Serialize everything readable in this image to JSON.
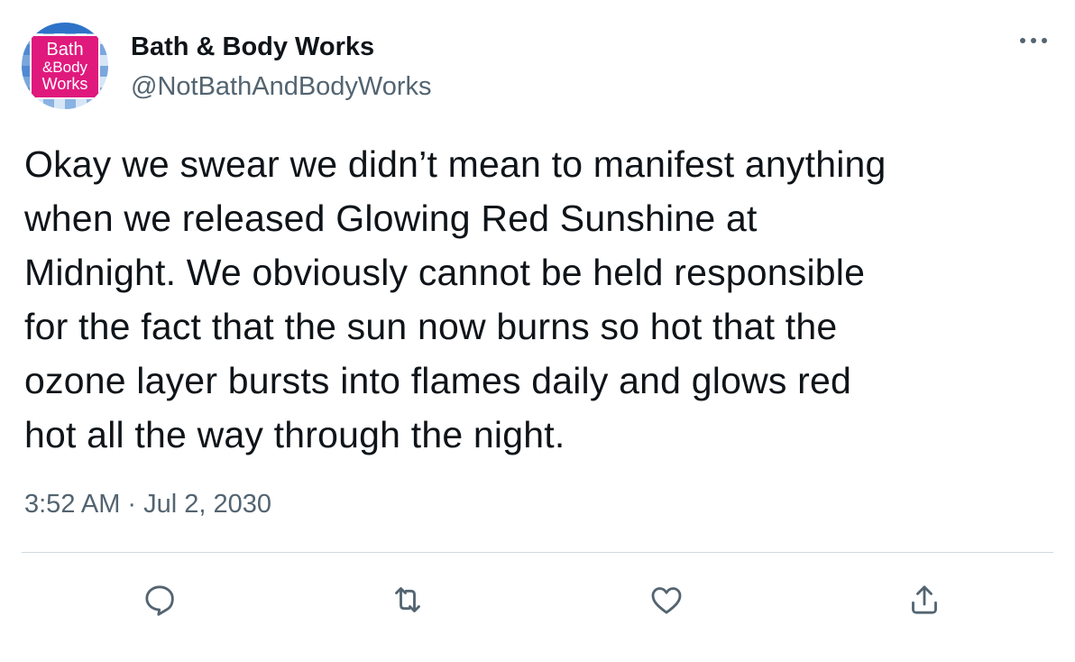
{
  "tweet": {
    "author": {
      "name": "Bath & Body Works",
      "handle": "@NotBathAndBodyWorks",
      "avatar_logo_text": [
        "Bath",
        "&Body",
        "Works"
      ]
    },
    "text": "Okay we swear we didn’t mean to manifest anything\nwhen we released Glowing Red Sunshine at\nMidnight. We obviously cannot be held responsible\nfor the fact that the sun now burns so hot that the\nozone layer bursts into flames daily and glows red\nhot all the way through the night.",
    "time": "3:52 AM",
    "separator": "·",
    "date": "Jul 2, 2030"
  },
  "actions": [
    {
      "name": "reply",
      "icon": "reply-icon"
    },
    {
      "name": "retweet",
      "icon": "retweet-icon"
    },
    {
      "name": "like",
      "icon": "heart-icon"
    },
    {
      "name": "share",
      "icon": "share-icon"
    }
  ],
  "colors": {
    "text_primary": "#0f1419",
    "text_secondary": "#536471",
    "divider": "#cfd9de",
    "icon": "#536471",
    "brand_pink": "#e0197d",
    "brand_blue": "#2e73c8"
  }
}
